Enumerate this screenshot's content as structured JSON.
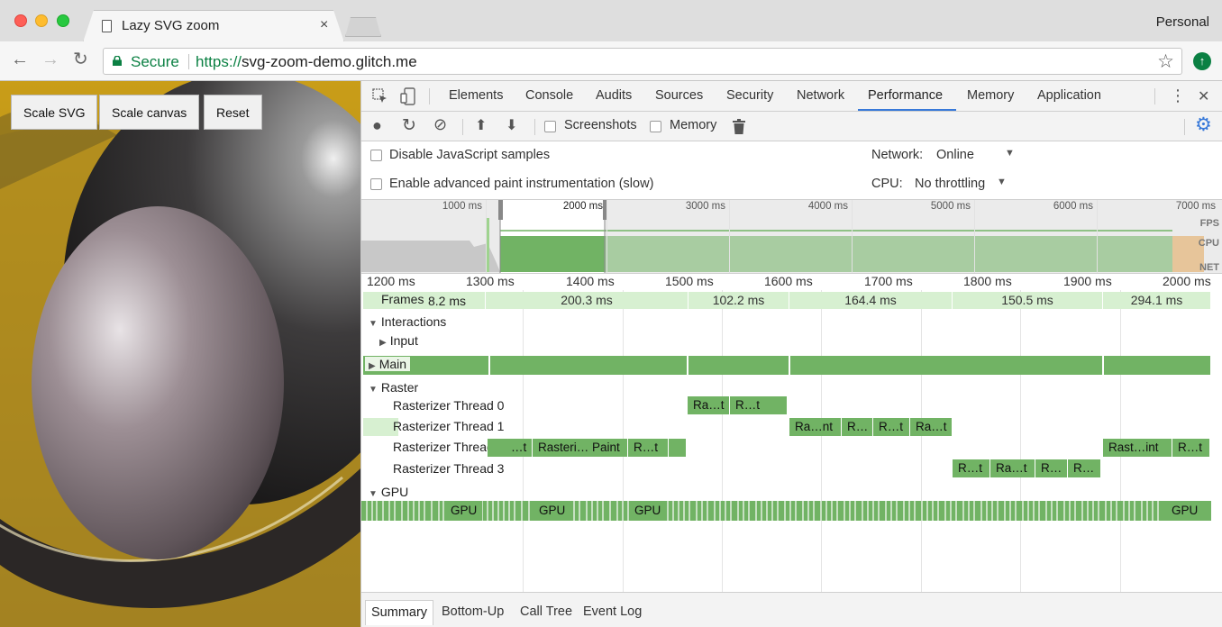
{
  "browser": {
    "tab_title": "Lazy SVG zoom",
    "tab_close": "×",
    "profile": "Personal",
    "back": "←",
    "forward": "→",
    "reload": "↻",
    "secure_label": "Secure",
    "url_scheme": "https://",
    "url_host": "svg-zoom-demo.glitch.me",
    "bookmark_star": "☆",
    "update_icon": "↑"
  },
  "page": {
    "buttons": [
      "Scale SVG",
      "Scale canvas",
      "Reset"
    ]
  },
  "devtools": {
    "tabs": [
      "Elements",
      "Console",
      "Audits",
      "Sources",
      "Security",
      "Network",
      "Performance",
      "Memory",
      "Application"
    ],
    "active_tab": "Performance",
    "more_icon": "⋮",
    "close_icon": "✕",
    "toolbar": {
      "record": "●",
      "reload": "↻",
      "clear": "⊘",
      "load": "⬆",
      "save": "⬇",
      "screenshots": "Screenshots",
      "memory": "Memory",
      "trash": "🗑",
      "gear": "⚙"
    },
    "settings": {
      "disable_js_samples": "Disable JavaScript samples",
      "paint_instrumentation": "Enable advanced paint instrumentation (slow)",
      "network_label": "Network:",
      "network_value": "Online",
      "cpu_label": "CPU:",
      "cpu_value": "No throttling",
      "dropdown_arrow": "▼"
    },
    "overview": {
      "tick_labels": [
        "1000 ms",
        "2000 ms",
        "3000 ms",
        "4000 ms",
        "5000 ms",
        "6000 ms",
        "7000 ms"
      ],
      "fps": "FPS",
      "cpu": "CPU",
      "net": "NET"
    },
    "ruler": [
      "1200 ms",
      "1300 ms",
      "1400 ms",
      "1500 ms",
      "1600 ms",
      "1700 ms",
      "1800 ms",
      "1900 ms",
      "2000 ms"
    ],
    "frames": {
      "label": "Frames",
      "values": [
        "8.2 ms",
        "200.3 ms",
        "102.2 ms",
        "164.4 ms",
        "150.5 ms",
        "294.1 ms"
      ]
    },
    "rows": {
      "interactions": "Interactions",
      "input": "Input",
      "main": "Main",
      "raster": "Raster",
      "rt0": "Rasterizer Thread 0",
      "rt1": "Rasterizer Thread 1",
      "rt2": "Rasterizer Thread 2",
      "rt3": "Rasterizer Thread 3",
      "gpu": "GPU",
      "expanded": "▼",
      "collapsed": "▶"
    },
    "raster_events": {
      "rt0": [
        "Ra…t",
        "R…t"
      ],
      "rt1": [
        "Ra…nt",
        "R…",
        "R…t",
        "Ra…t"
      ],
      "rt2": [
        "…t",
        "Rasteri… Paint",
        "R…t",
        "Rast…int",
        "R…t"
      ],
      "rt3": [
        "R…t",
        "Ra…t",
        "R…",
        "R…"
      ]
    },
    "gpu_events": [
      "GPU",
      "GPU",
      "GPU",
      "GPU"
    ],
    "bottom_tabs": [
      "Summary",
      "Bottom-Up",
      "Call Tree",
      "Event Log"
    ],
    "active_bottom_tab": "Summary"
  }
}
